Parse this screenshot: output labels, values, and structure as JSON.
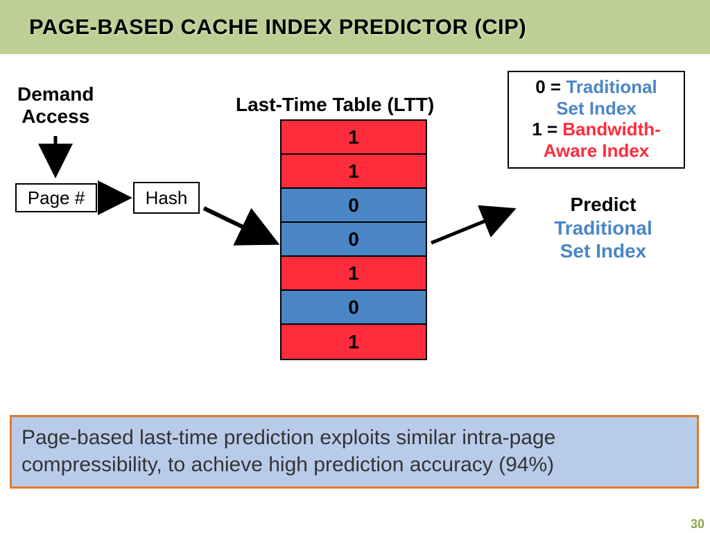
{
  "title": "PAGE-BASED CACHE INDEX PREDICTOR (CIP)",
  "demand_label_line1": "Demand",
  "demand_label_line2": "Access",
  "page_box": "Page #",
  "hash_box": "Hash",
  "ltt_heading": "Last-Time Table (LTT)",
  "ltt_rows": [
    {
      "value": "1",
      "color": "red"
    },
    {
      "value": "1",
      "color": "red"
    },
    {
      "value": "0",
      "color": "blue"
    },
    {
      "value": "0",
      "color": "blue"
    },
    {
      "value": "1",
      "color": "red"
    },
    {
      "value": "0",
      "color": "blue"
    },
    {
      "value": "1",
      "color": "red"
    }
  ],
  "legend": {
    "zero_prefix": "0 = ",
    "zero_label_line1": "Traditional",
    "zero_label_line2": "Set Index",
    "one_prefix": "1 = ",
    "one_label_line1": "Bandwidth-",
    "one_label_line2": "Aware Index"
  },
  "predict": {
    "head": "Predict",
    "line1": "Traditional",
    "line2": "Set Index"
  },
  "summary": "Page-based last-time prediction exploits similar intra-page compressibility, to achieve high prediction accuracy (94%)",
  "page_number": "30",
  "chart_data": {
    "type": "table",
    "title": "Last-Time Table (LTT)",
    "values": [
      1,
      1,
      0,
      0,
      1,
      0,
      1
    ],
    "encoding": {
      "0": "Traditional Set Index",
      "1": "Bandwidth-Aware Index"
    },
    "selected_index": 3,
    "prediction": "Traditional Set Index",
    "accuracy_pct": 94
  }
}
